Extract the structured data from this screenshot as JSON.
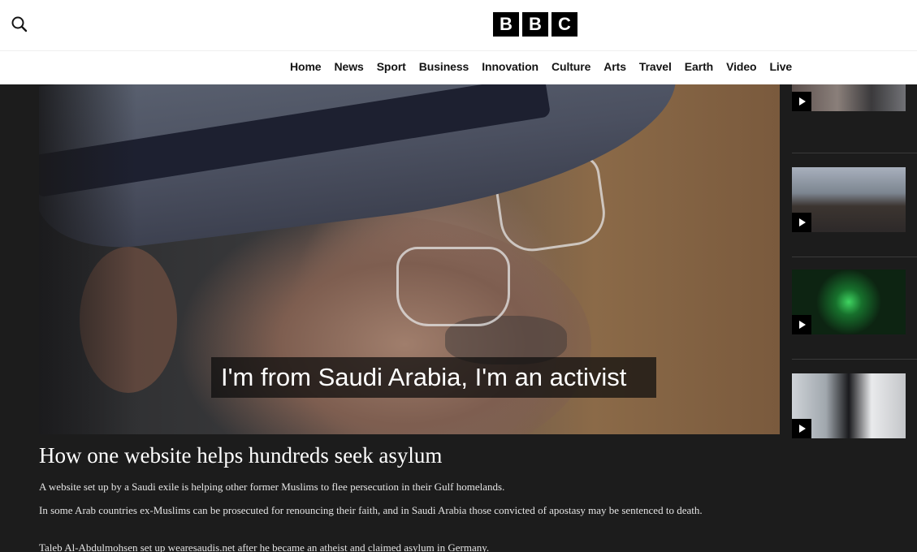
{
  "header": {
    "logo_letters": [
      "B",
      "B",
      "C"
    ],
    "search_icon": "search-icon",
    "nav": [
      "Home",
      "News",
      "Sport",
      "Business",
      "Innovation",
      "Culture",
      "Arts",
      "Travel",
      "Earth",
      "Video",
      "Live"
    ]
  },
  "video": {
    "caption": "I'm from Saudi Arabia, I'm an activist"
  },
  "sidebar": {
    "play_icon": "play-icon",
    "thumbnail_count_visible": 4
  },
  "article": {
    "headline": "How one website helps hundreds seek asylum",
    "paragraphs": [
      "A website set up by a Saudi exile is helping other former Muslims to flee persecution in their Gulf homelands.",
      "In some Arab countries ex-Muslims can be prosecuted for renouncing their faith, and in Saudi Arabia those convicted of apostasy may be sentenced to death.",
      "Taleb Al-Abdulmohsen set up wearesaudis.net after he became an atheist and claimed asylum in Germany."
    ]
  },
  "colors": {
    "header_bg": "#ffffff",
    "page_bg": "#1c1c1c",
    "logo_bg": "#000000",
    "text_light": "#ffffff"
  }
}
